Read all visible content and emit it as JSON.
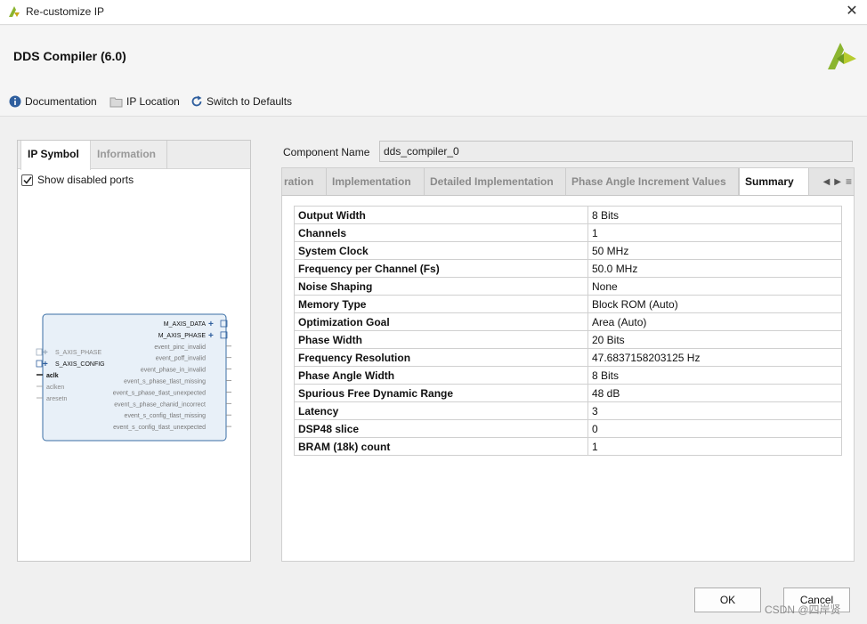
{
  "window": {
    "title": "Re-customize IP",
    "close_glyph": "✕"
  },
  "header": {
    "ip_title": "DDS Compiler (6.0)",
    "logo_icon": "xilinx-logo"
  },
  "toolbar": {
    "documentation": "Documentation",
    "ip_location": "IP Location",
    "switch_defaults": "Switch to Defaults"
  },
  "left": {
    "tabs": [
      "IP Symbol",
      "Information"
    ],
    "show_disabled_ports": "Show disabled ports",
    "show_disabled_checked": true,
    "symbol": {
      "right_ports": [
        "M_AXIS_DATA",
        "M_AXIS_PHASE",
        "event_pinc_invalid",
        "event_poff_invalid",
        "event_phase_in_invalid",
        "event_s_phase_tlast_missing",
        "event_s_phase_tlast_unexpected",
        "event_s_phase_chanid_incorrect",
        "event_s_config_tlast_missing",
        "event_s_config_tlast_unexpected"
      ],
      "left_ports": [
        "S_AXIS_PHASE",
        "S_AXIS_CONFIG",
        "aclk",
        "aclken",
        "aresetn"
      ]
    }
  },
  "right": {
    "component_name_label": "Component Name",
    "component_name_value": "dds_compiler_0",
    "tabs": [
      "ration",
      "Implementation",
      "Detailed Implementation",
      "Phase Angle Increment Values",
      "Summary"
    ],
    "active_tab": "Summary",
    "summary": [
      {
        "key": "Output Width",
        "value": "8 Bits"
      },
      {
        "key": "Channels",
        "value": "1"
      },
      {
        "key": "System Clock",
        "value": "50 MHz"
      },
      {
        "key": "Frequency per Channel (Fs)",
        "value": "50.0 MHz"
      },
      {
        "key": "Noise Shaping",
        "value": "None"
      },
      {
        "key": "Memory Type",
        "value": "Block ROM (Auto)"
      },
      {
        "key": "Optimization Goal",
        "value": "Area (Auto)"
      },
      {
        "key": "Phase Width",
        "value": "20 Bits"
      },
      {
        "key": "Frequency Resolution",
        "value": "47.6837158203125 Hz"
      },
      {
        "key": "Phase Angle Width",
        "value": "8 Bits"
      },
      {
        "key": "Spurious Free Dynamic Range",
        "value": "48 dB"
      },
      {
        "key": "Latency",
        "value": "3"
      },
      {
        "key": "DSP48 slice",
        "value": "0"
      },
      {
        "key": "BRAM (18k) count",
        "value": "1"
      }
    ]
  },
  "buttons": {
    "ok": "OK",
    "cancel": "Cancel"
  },
  "watermark": "CSDN @四岸贤",
  "colors": {
    "accent_green": "#8bb530",
    "symbol_fill": "#e8f0f8",
    "symbol_stroke": "#3a6ea5"
  }
}
